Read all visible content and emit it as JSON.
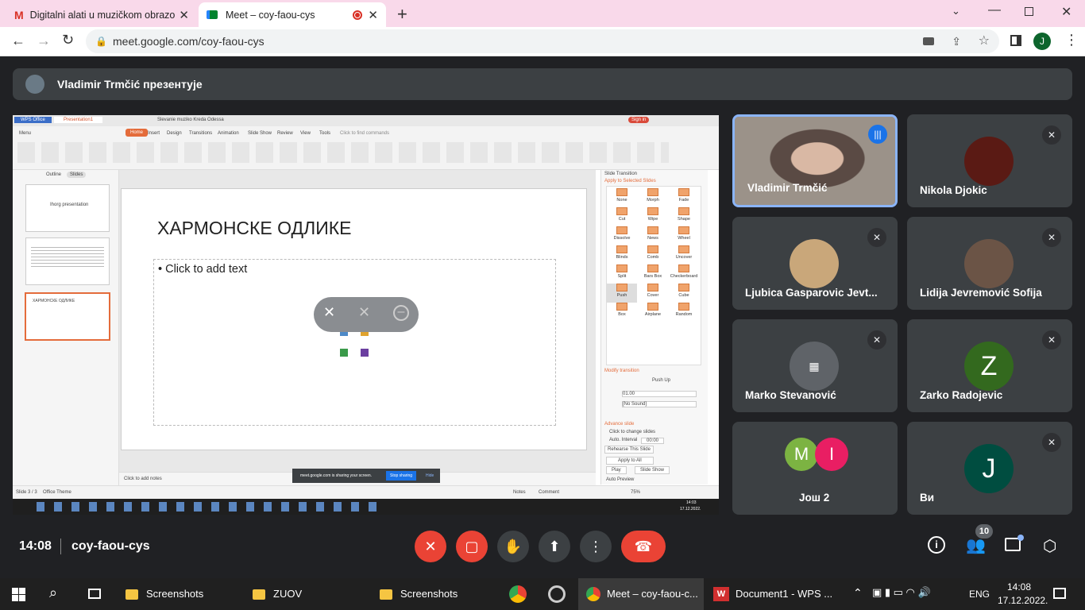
{
  "browser": {
    "tabs": [
      {
        "title": "Digitalni alati u muzičkom obrazo"
      },
      {
        "title": "Meet – coy-faou-cys"
      }
    ],
    "url": "meet.google.com/coy-faou-cys",
    "profile": "J"
  },
  "meet": {
    "presenter": "Vladimir Trmčić презентује",
    "time": "14:08",
    "code": "coy-faou-cys",
    "participants_count": "10",
    "tiles": [
      {
        "name": "Vladimir Trmčić"
      },
      {
        "name": "Nikola Djokic"
      },
      {
        "name": "Ljubica Gasparovic Jevt..."
      },
      {
        "name": "Lidija Jevremović Sofija"
      },
      {
        "name": "Marko Stevanović"
      },
      {
        "name": "Zarko Radojevic"
      },
      {
        "name": "Још 2",
        "letters": [
          "M",
          "I"
        ]
      },
      {
        "name": "Ви",
        "letter": "J"
      }
    ],
    "z_letter": "Z"
  },
  "ppt": {
    "tabs": [
      "WPS Office",
      "Presentation1",
      "Slevanie muziko Kreda Odessa"
    ],
    "menu": [
      "Menu",
      "Home",
      "Insert",
      "Design",
      "Transitions",
      "Animation",
      "Slide Show",
      "Review",
      "View",
      "Tools",
      "Click to find commands"
    ],
    "slide_title": "ХАРМОНСКЕ ОДЛИКЕ",
    "placeholder": "• Click to add text",
    "notes": "Click to add notes",
    "status": "Slide 3 / 3",
    "theme": "Office Theme",
    "panel_title": "Slide Transition",
    "apply_label": "Apply to Selected Slides",
    "transitions": [
      "None",
      "Morph",
      "Fade",
      "Cut",
      "Wipe",
      "Shape",
      "Dissolve",
      "News",
      "Wheel",
      "Blinds",
      "Comb",
      "Uncover",
      "Split",
      "Bars Box",
      "Checkerboard",
      "Push",
      "Cover",
      "Cube",
      "Box",
      "Airplane",
      "Random"
    ],
    "modify": "Modify transition",
    "effect": "Push Up",
    "speed": "01.00",
    "sound": "[No Sound]",
    "advance": "Advance slide",
    "click_change": "Click to change slides",
    "auto": "Auto. Interval",
    "auto_val": "00:00",
    "rehearse": "Rehearse This Slide",
    "apply_all": "Apply to All",
    "play": "Play",
    "slideshow": "Slide Show",
    "autopreview": "Auto Preview",
    "sharing": "meet.google.com is sharing your screen.",
    "stop": "Stop sharing",
    "hide": "Hide",
    "outline_tab": "Outline",
    "slides_tab": "Slides",
    "thumb1": "Ihorg presentation",
    "thumb3": "ХАРМОНСКЕ ОДЛИКЕ",
    "clock": "14:03",
    "clock_date": "17.12.2022.",
    "notes_btn": "Notes",
    "comment": "Comment",
    "zoom": "75%"
  },
  "taskbar": {
    "items": [
      "Screenshots",
      "ZUOV",
      "Screenshots",
      "Meet – coy-faou-c...",
      "Document1 - WPS ..."
    ],
    "lang": "ENG",
    "time": "14:08",
    "date": "17.12.2022."
  }
}
